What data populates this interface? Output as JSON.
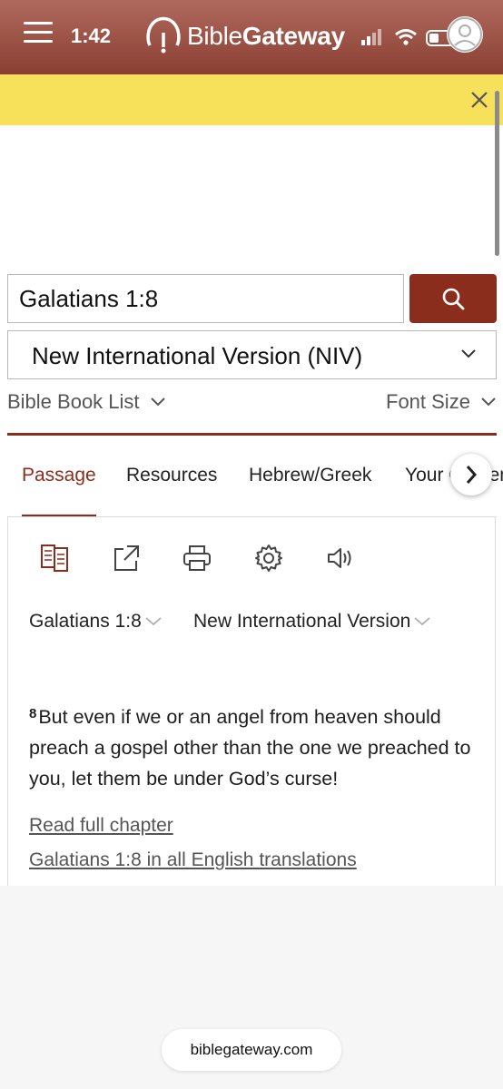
{
  "status_bar": {
    "time": "1:42"
  },
  "header": {
    "logo_part1": "Bible",
    "logo_part2": "Gateway",
    "menu_icon": "hamburger-icon",
    "account_icon": "user-avatar-icon"
  },
  "banner": {
    "close_icon": "close-icon",
    "color": "#f7e15a"
  },
  "search": {
    "query": "Galatians 1:8",
    "button_icon": "search-icon",
    "version": "New International Version (NIV)"
  },
  "links": {
    "book_list": "Bible Book List",
    "font_size": "Font Size"
  },
  "tabs": [
    {
      "label": "Passage"
    },
    {
      "label": "Resources"
    },
    {
      "label": "Hebrew/Greek"
    },
    {
      "label": "Your Content"
    }
  ],
  "toolbar_icons": [
    "parallel-icon",
    "share-icon",
    "print-icon",
    "settings-icon",
    "audio-icon"
  ],
  "passage": {
    "reference": "Galatians 1:8",
    "version": "New International Version",
    "verse_number": "8",
    "verse_text": "But even if we or an angel from heaven should preach a gospel other than the one we preached to you, let them be under God’s curse!",
    "read_full_chapter": "Read full chapter",
    "all_translations": "Galatians 1:8 in all English translations"
  },
  "browser": {
    "url": "biblegateway.com"
  },
  "colors": {
    "brand_red": "#8b2d1d",
    "header_top": "#b06a5d",
    "header_bottom": "#8a3f33"
  }
}
